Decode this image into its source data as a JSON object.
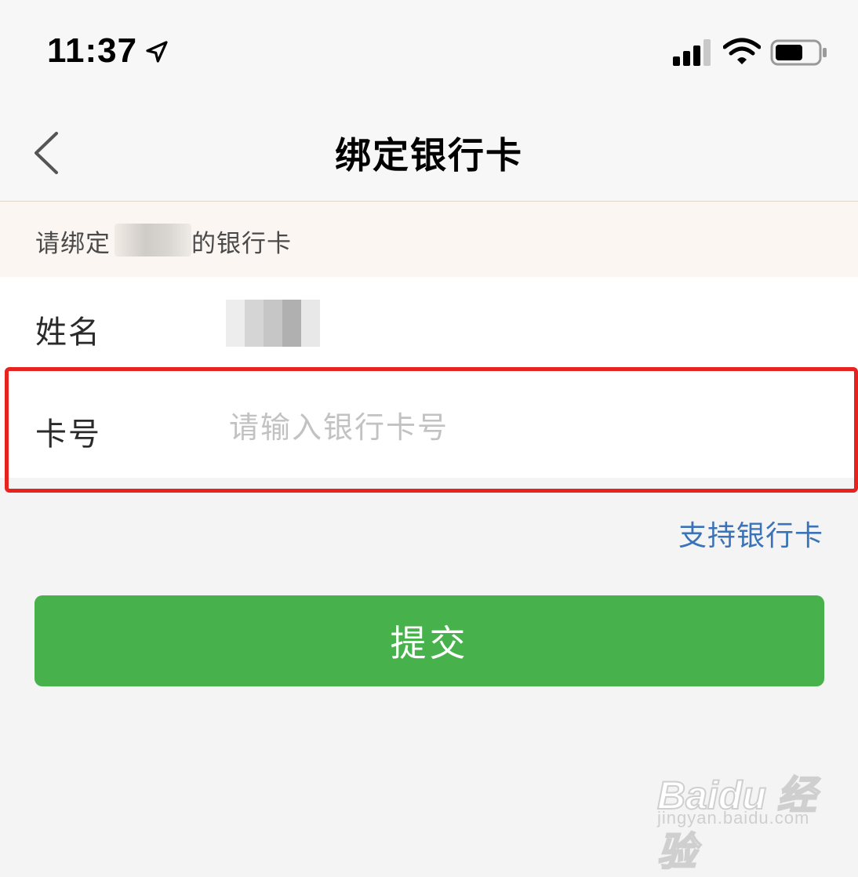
{
  "status_bar": {
    "time": "11:37",
    "icons": [
      "location-arrow-icon",
      "signal-icon",
      "wifi-icon",
      "battery-icon"
    ]
  },
  "nav": {
    "title": "绑定银行卡",
    "back_icon": "chevron-left-icon"
  },
  "notice": {
    "prefix": "请绑定",
    "suffix": "的银行卡"
  },
  "form": {
    "name_label": "姓名",
    "card_label": "卡号",
    "card_placeholder": "请输入银行卡号",
    "card_value": ""
  },
  "support_link": "支持银行卡",
  "submit_label": "提交",
  "watermark": {
    "logo": "Baidu 经验",
    "sub": "jingyan.baidu.com"
  },
  "colors": {
    "accent_green": "#47b24b",
    "link_blue": "#3a73b8",
    "highlight_red": "#e8231f"
  }
}
